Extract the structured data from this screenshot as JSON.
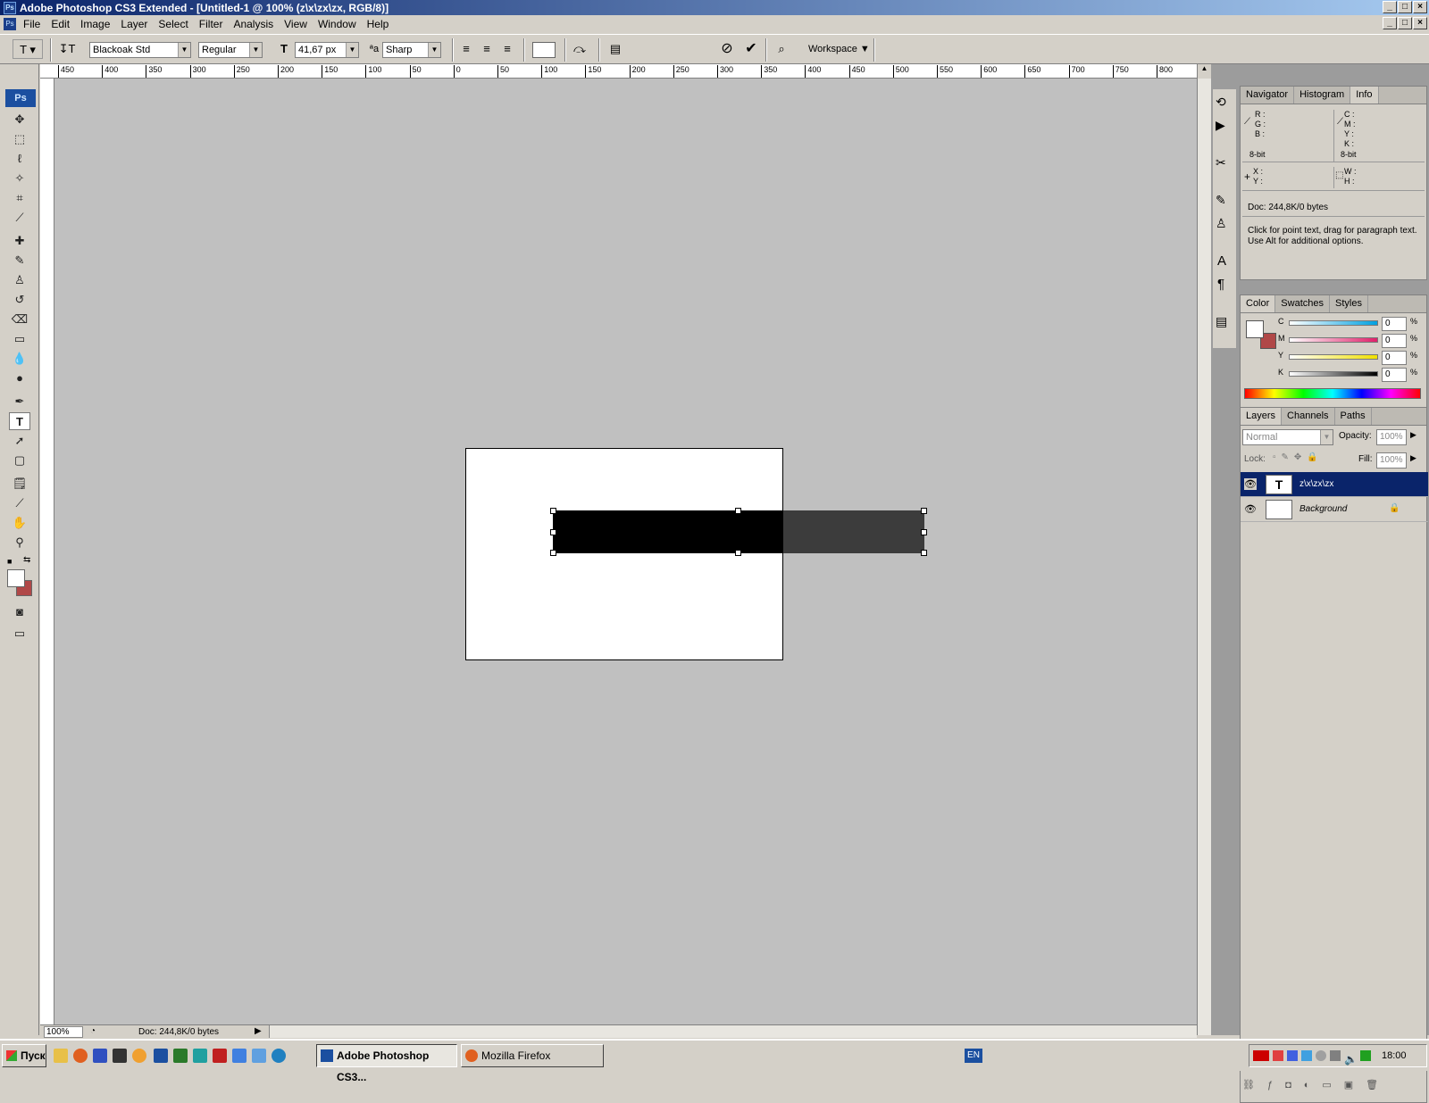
{
  "window": {
    "title": "Adobe Photoshop CS3 Extended - [Untitled-1 @ 100% (z\\x\\zx\\zx, RGB/8)]"
  },
  "menu": [
    "File",
    "Edit",
    "Image",
    "Layer",
    "Select",
    "Filter",
    "Analysis",
    "View",
    "Window",
    "Help"
  ],
  "options": {
    "font_family": "Blackoak Std",
    "font_style": "Regular",
    "font_size": "41,67 px",
    "antialias": "Sharp",
    "workspace": "Workspace ▼"
  },
  "ruler_top_labels": [
    "450",
    "400",
    "350",
    "300",
    "250",
    "200",
    "150",
    "100",
    "50",
    "0",
    "50",
    "100",
    "150",
    "200",
    "250",
    "300",
    "350",
    "400",
    "450",
    "500",
    "550",
    "600",
    "650",
    "700",
    "750",
    "800"
  ],
  "info_panel": {
    "tabs": [
      "Navigator",
      "Histogram",
      "Info"
    ],
    "rgb_labels": [
      "R :",
      "G :",
      "B :"
    ],
    "cmyk_labels": [
      "C :",
      "M :",
      "Y :",
      "K :"
    ],
    "bit_left": "8-bit",
    "bit_right": "8-bit",
    "xy_labels": [
      "X :",
      "Y :"
    ],
    "wh_labels": [
      "W :",
      "H :"
    ],
    "doc": "Doc: 244,8K/0 bytes",
    "hint": "Click for point text, drag for paragraph text. Use Alt for additional options."
  },
  "color_panel": {
    "tabs": [
      "Color",
      "Swatches",
      "Styles"
    ],
    "channels": [
      {
        "label": "C",
        "value": "0"
      },
      {
        "label": "M",
        "value": "0"
      },
      {
        "label": "Y",
        "value": "0"
      },
      {
        "label": "K",
        "value": "0"
      }
    ],
    "percent": "%"
  },
  "layers_panel": {
    "tabs": [
      "Layers",
      "Channels",
      "Paths"
    ],
    "blend_mode": "Normal",
    "opacity_label": "Opacity:",
    "opacity": "100%",
    "lock_label": "Lock:",
    "fill_label": "Fill:",
    "fill": "100%",
    "layers": [
      {
        "name": "z\\x\\zx\\zx",
        "thumb": "T"
      },
      {
        "name": "Background",
        "thumb": ""
      }
    ]
  },
  "status": {
    "zoom": "100%",
    "doc": "Doc: 244,8K/0 bytes"
  },
  "taskbar": {
    "start": "Пуск",
    "items": [
      "Adobe Photoshop CS3...",
      "Mozilla Firefox"
    ],
    "lang": "EN",
    "time": "18:00"
  },
  "colors": {
    "accent": "#0a246a",
    "foreground": "#ffffff",
    "background": "#b04848"
  }
}
